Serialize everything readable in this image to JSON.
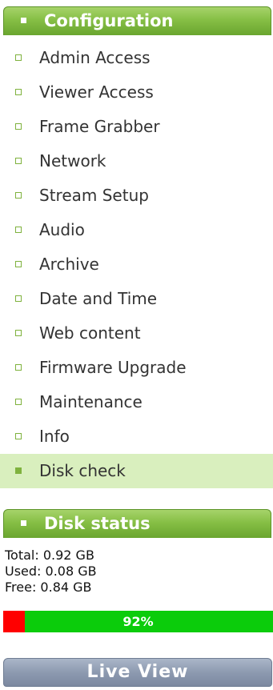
{
  "config": {
    "title": "Configuration",
    "items": [
      {
        "label": "Admin Access"
      },
      {
        "label": "Viewer Access"
      },
      {
        "label": "Frame Grabber"
      },
      {
        "label": "Network"
      },
      {
        "label": "Stream Setup"
      },
      {
        "label": "Audio"
      },
      {
        "label": "Archive"
      },
      {
        "label": "Date and Time"
      },
      {
        "label": "Web content"
      },
      {
        "label": "Firmware Upgrade"
      },
      {
        "label": "Maintenance"
      },
      {
        "label": "Info"
      },
      {
        "label": "Disk check",
        "active": true
      }
    ]
  },
  "disk": {
    "title": "Disk status",
    "total": "Total: 0.92 GB",
    "used": "Used: 0.08 GB",
    "free": "Free: 0.84 GB",
    "percent_label": "92%",
    "free_fraction": 0.92
  },
  "live_view": {
    "label": "Live View"
  },
  "colors": {
    "accent_green": "#7fb23e",
    "active_bg": "#d9efbe",
    "bar_free": "#0bcc0b",
    "bar_used": "#ff0000"
  }
}
